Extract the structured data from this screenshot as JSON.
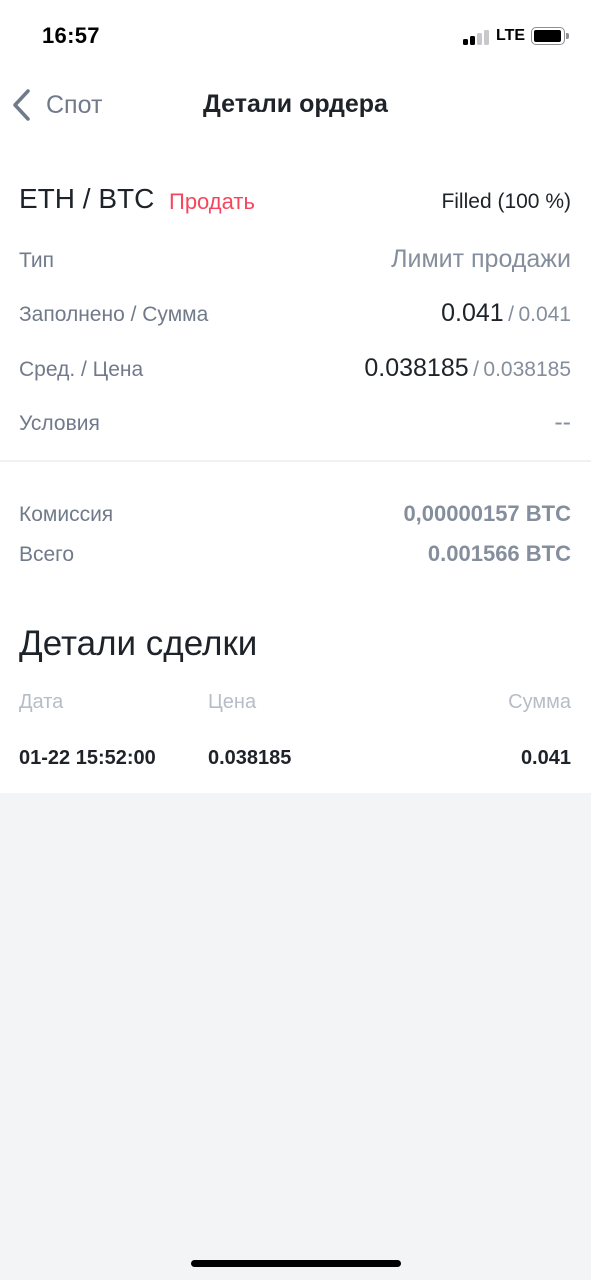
{
  "status_bar": {
    "time": "16:57",
    "network": "LTE"
  },
  "nav": {
    "back_label": "Спот",
    "title": "Детали ордера"
  },
  "order": {
    "pair": "ETH / BTC",
    "side": "Продать",
    "status": "Filled (100 %)",
    "type_label": "Тип",
    "type_value": "Лимит продажи",
    "filled_label": "Заполнено / Сумма",
    "filled_value": "0.041",
    "amount_value": "0.041",
    "avg_label": "Сред. / Цена",
    "avg_value": "0.038185",
    "price_value": "0.038185",
    "conditions_label": "Условия",
    "conditions_value": "--",
    "separator": "/"
  },
  "fees": {
    "commission_label": "Комиссия",
    "commission_value": "0,00000157 BTC",
    "total_label": "Всего",
    "total_value": "0.001566 BTC"
  },
  "trades": {
    "title": "Детали сделки",
    "columns": {
      "date": "Дата",
      "price": "Цена",
      "amount": "Сумма"
    },
    "rows": [
      {
        "date": "01-22 15:52:00",
        "price": "0.038185",
        "amount": "0.041"
      }
    ]
  },
  "colors": {
    "sell": "#f6465d",
    "text_primary": "#1e2329",
    "text_secondary": "#707a8a"
  }
}
